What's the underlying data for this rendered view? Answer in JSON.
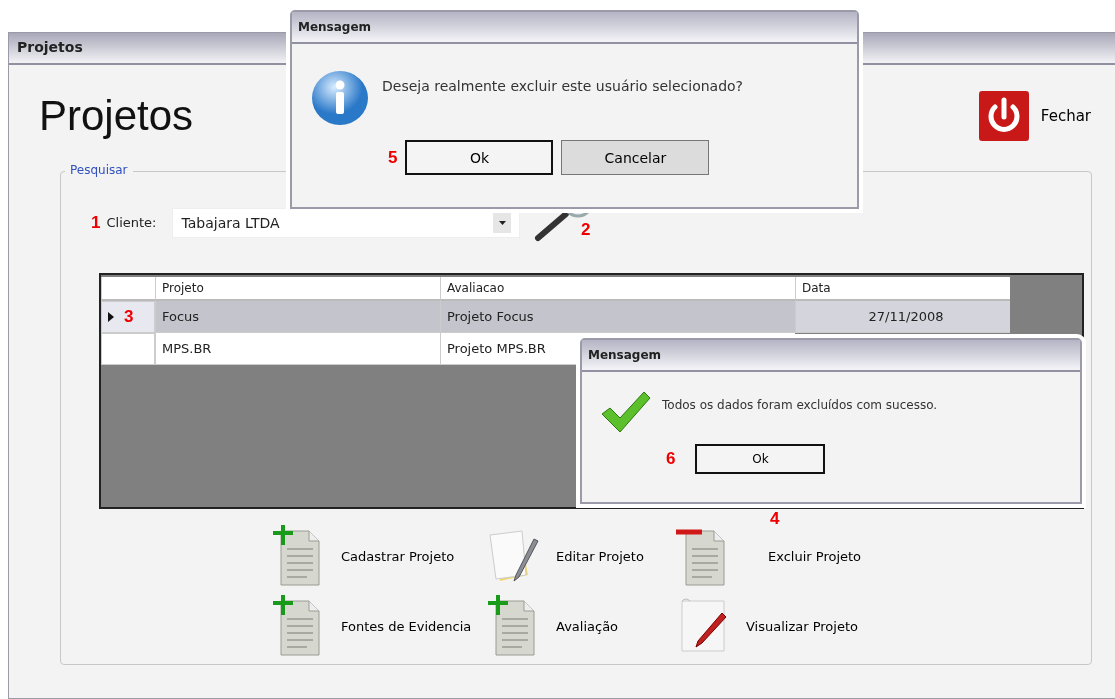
{
  "window": {
    "title": "Projetos"
  },
  "heading": "Projetos",
  "close_button": {
    "label": "Fechar"
  },
  "search_group": {
    "legend": "Pesquisar",
    "client_label": "Cliente:",
    "client_value": "Tabajara LTDA",
    "client_marker": "1",
    "search_marker": "2"
  },
  "table": {
    "columns": [
      "Projeto",
      "Avaliacao",
      "Data"
    ],
    "rows": [
      {
        "marker": "3",
        "selected": true,
        "cells": [
          "Focus",
          "Projeto Focus",
          "27/11/2008"
        ]
      },
      {
        "selected": false,
        "cells": [
          "MPS.BR",
          "Projeto MPS.BR"
        ]
      }
    ]
  },
  "actions": [
    {
      "label": "Cadastrar Projeto",
      "kind": "add"
    },
    {
      "label": "Editar Projeto",
      "kind": "edit"
    },
    {
      "label": "Excluir Projeto",
      "kind": "remove",
      "marker": "4"
    },
    {
      "label": "Fontes de Evidencia",
      "kind": "add"
    },
    {
      "label": "Avaliação",
      "kind": "add"
    },
    {
      "label": "Visualizar Projeto",
      "kind": "view"
    }
  ],
  "dialogs": [
    {
      "title": "Mensagem",
      "kind": "info",
      "message": "Deseja realmente excluir este usuário selecionado?",
      "marker": "5",
      "buttons": [
        {
          "label": "Ok",
          "focused": true
        },
        {
          "label": "Cancelar",
          "focused": false
        }
      ]
    },
    {
      "title": "Mensagem",
      "kind": "success",
      "message": "Todos os dados foram excluídos com sucesso.",
      "marker": "6",
      "buttons": [
        {
          "label": "Ok",
          "focused": true
        }
      ]
    }
  ]
}
